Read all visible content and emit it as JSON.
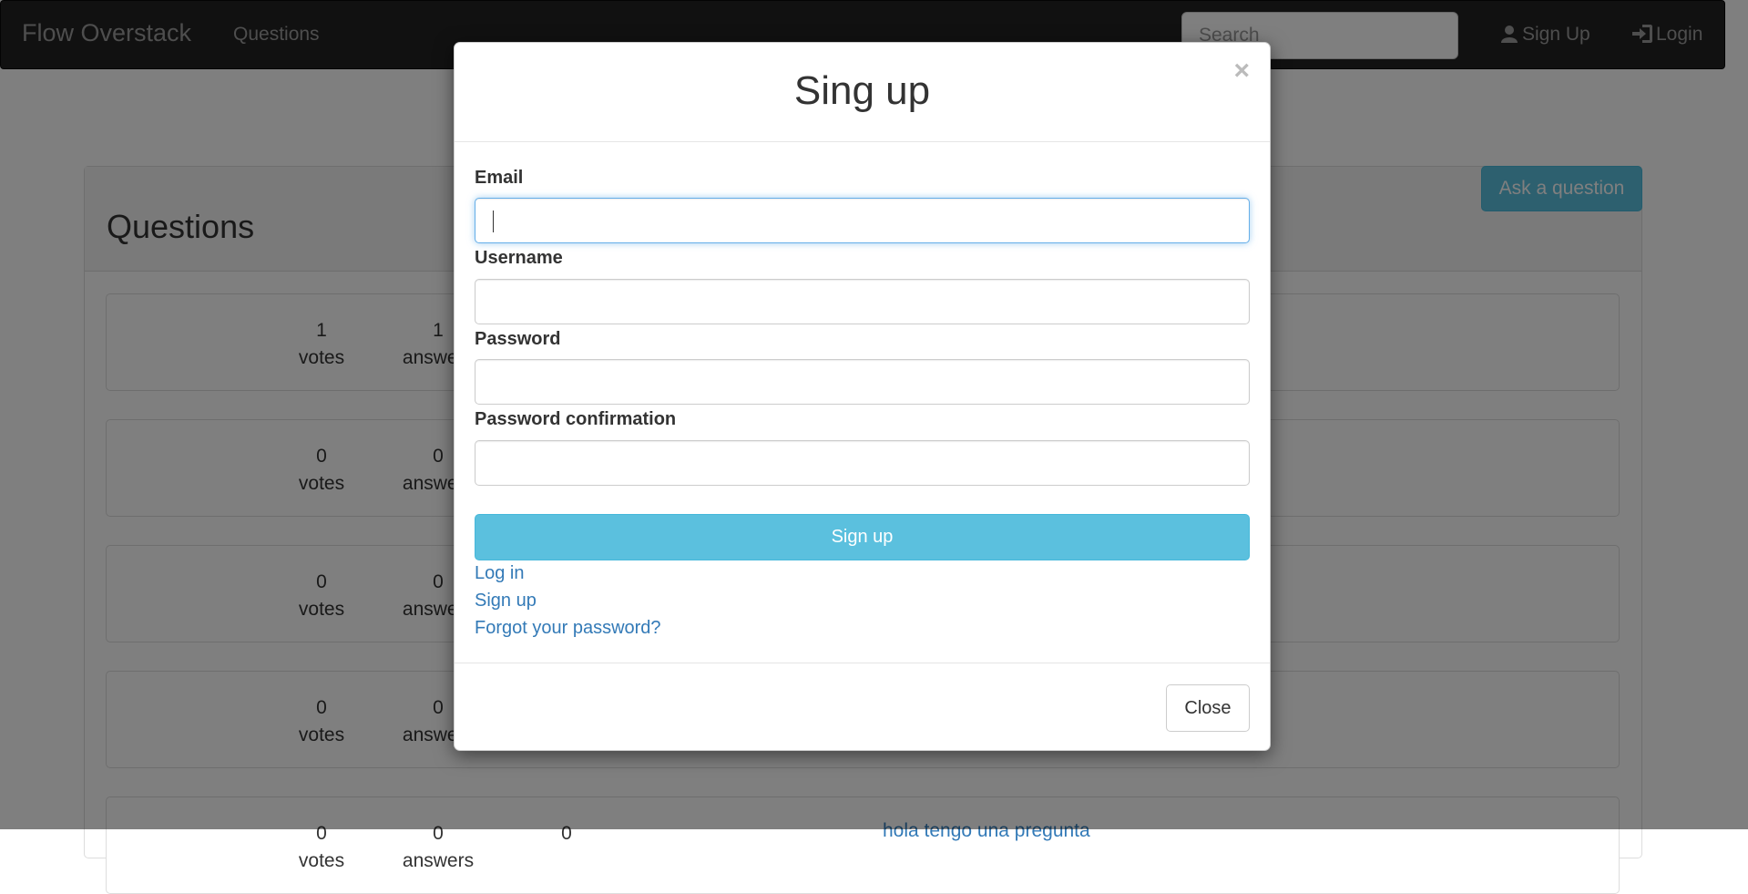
{
  "navbar": {
    "brand": "Flow Overstack",
    "questions_link": "Questions",
    "search_placeholder": "Search",
    "signup_link": "Sign Up",
    "login_link": "Login"
  },
  "panel": {
    "title": "Questions",
    "ask_button": "Ask a question"
  },
  "questions": [
    {
      "votes": "1",
      "votes_label": "votes",
      "answers": "1",
      "answers_label": "answers",
      "views": "",
      "title": ""
    },
    {
      "votes": "0",
      "votes_label": "votes",
      "answers": "0",
      "answers_label": "answers",
      "views": "",
      "title": ""
    },
    {
      "votes": "0",
      "votes_label": "votes",
      "answers": "0",
      "answers_label": "answers",
      "views": "",
      "title": ""
    },
    {
      "votes": "0",
      "votes_label": "votes",
      "answers": "0",
      "answers_label": "answers",
      "views": "",
      "title": ""
    },
    {
      "votes": "0",
      "votes_label": "votes",
      "answers": "0",
      "answers_label": "answers",
      "views": "0",
      "title": "hola tengo una pregunta"
    }
  ],
  "modal": {
    "title": "Sing up",
    "close_symbol": "×",
    "email_label": "Email",
    "email_value": "",
    "username_label": "Username",
    "username_value": "",
    "password_label": "Password",
    "password_value": "",
    "password_confirmation_label": "Password confirmation",
    "password_confirmation_value": "",
    "submit_button": "Sign up",
    "links": {
      "log_in": "Log in",
      "sign_up": "Sign up",
      "forgot_password": "Forgot your password?"
    },
    "close_button": "Close"
  },
  "colors": {
    "navbar_bg": "#222222",
    "accent_info": "#5bc0de",
    "link": "#337ab7",
    "focus_border": "#66afe9"
  },
  "icons": {
    "signup": "user-icon",
    "login": "log-in-icon",
    "modal_close": "close-icon"
  }
}
